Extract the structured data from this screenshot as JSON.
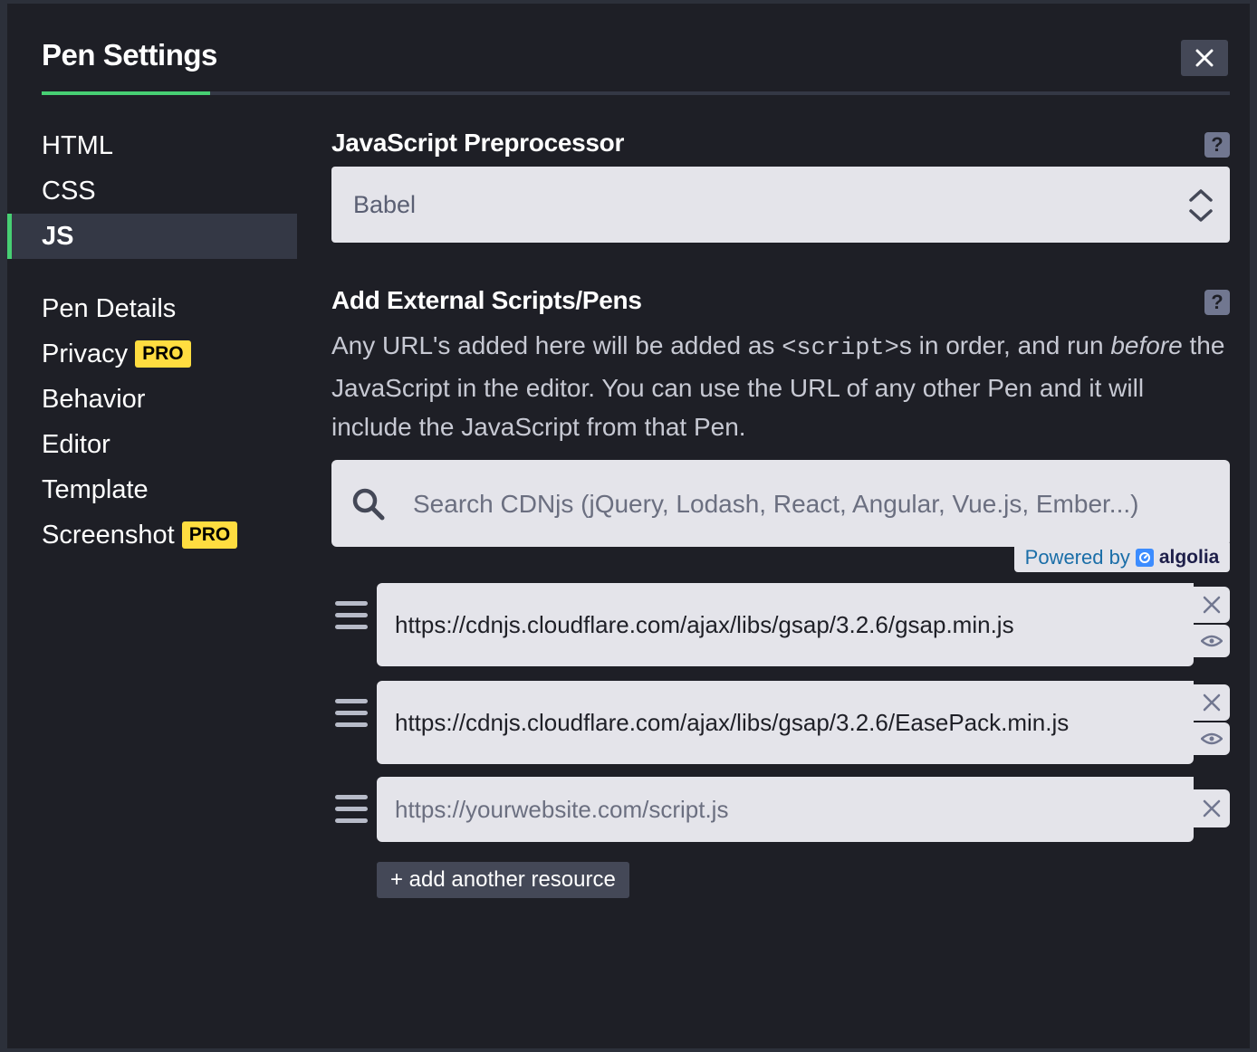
{
  "header": {
    "title": "Pen Settings"
  },
  "sidebar": {
    "languages": [
      {
        "label": "HTML"
      },
      {
        "label": "CSS"
      },
      {
        "label": "JS"
      }
    ],
    "settings": [
      {
        "label": "Pen Details"
      },
      {
        "label": "Privacy",
        "badge": "PRO"
      },
      {
        "label": "Behavior"
      },
      {
        "label": "Editor"
      },
      {
        "label": "Template"
      },
      {
        "label": "Screenshot",
        "badge": "PRO"
      }
    ]
  },
  "preprocessor": {
    "title": "JavaScript Preprocessor",
    "help": "?",
    "selected": "Babel"
  },
  "external": {
    "title": "Add External Scripts/Pens",
    "help": "?",
    "desc_part1": "Any URL's added here will be added as ",
    "desc_code": "<script>",
    "desc_part2": "s in order, and run ",
    "desc_em": "before",
    "desc_part3": " the JavaScript in the editor. You can use the URL of any other Pen and it will include the JavaScript from that Pen.",
    "search_placeholder": "Search CDNjs (jQuery, Lodash, React, Angular, Vue.js, Ember...)",
    "powered_by": "Powered by",
    "powered_brand": "algolia",
    "resources": [
      {
        "value": "https://cdnjs.cloudflare.com/ajax/libs/gsap/3.2.6/gsap.min.js",
        "placeholder": ""
      },
      {
        "value": "https://cdnjs.cloudflare.com/ajax/libs/gsap/3.2.6/EasePack.min.js",
        "placeholder": ""
      },
      {
        "value": "",
        "placeholder": "https://yourwebsite.com/script.js"
      }
    ],
    "add_label": "+ add another resource"
  },
  "colors": {
    "accent": "#47cf73",
    "pro": "#ffdd40",
    "bg": "#1e1f26",
    "field": "#e4e4ea"
  },
  "icons": [
    "close-icon",
    "question-icon",
    "select-arrows-icon",
    "search-icon",
    "algolia-icon",
    "drag-handle-icon",
    "remove-icon",
    "eye-icon"
  ]
}
